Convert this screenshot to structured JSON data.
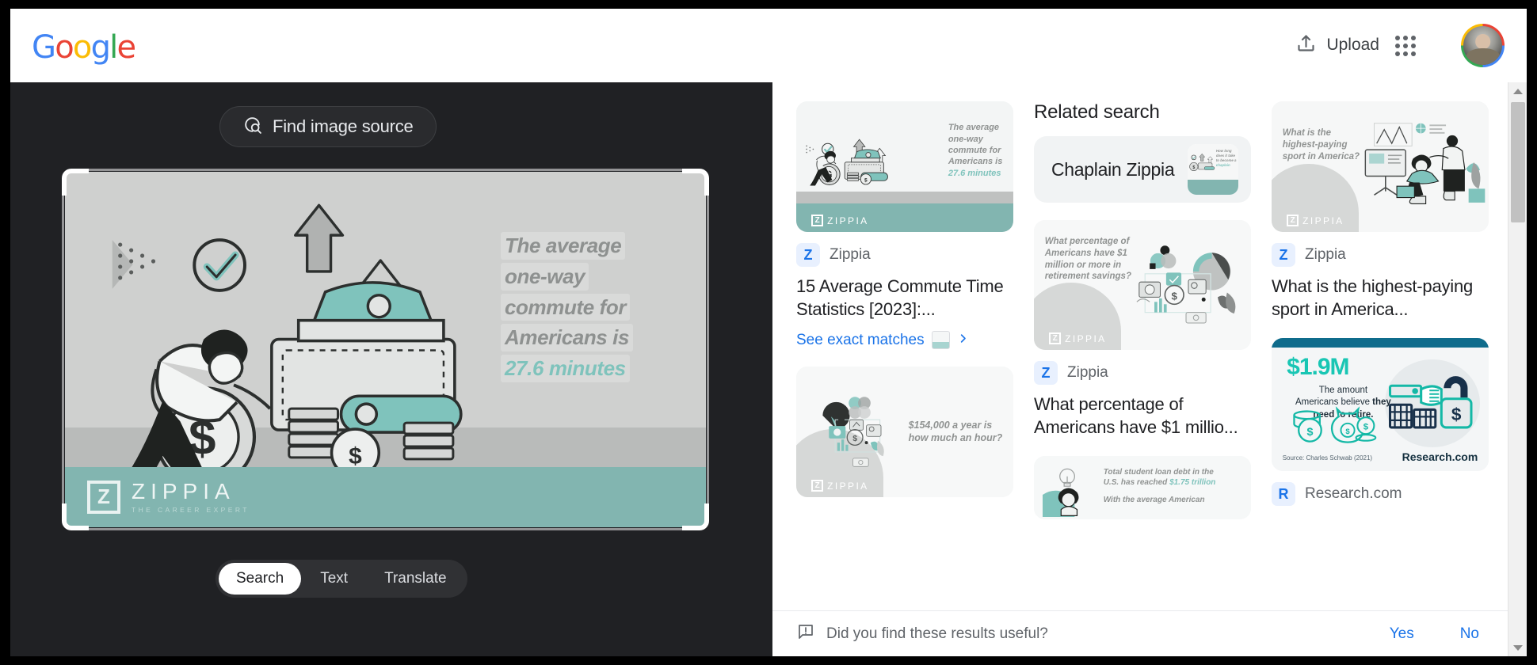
{
  "topbar": {
    "logo_letters": [
      "G",
      "o",
      "o",
      "g",
      "l",
      "e"
    ],
    "upload_label": "Upload",
    "upload_icon": "upload-icon",
    "apps_icon": "apps-grid-icon",
    "avatar_icon": "user-avatar"
  },
  "viewer": {
    "find_source_label": "Find image source",
    "find_source_icon": "image-search-icon",
    "tabs": [
      {
        "label": "Search",
        "active": true
      },
      {
        "label": "Text",
        "active": false
      },
      {
        "label": "Translate",
        "active": false
      }
    ],
    "hero": {
      "lines": [
        "The average",
        "one-way",
        "commute for",
        "Americans is"
      ],
      "accent_line": "27.6 minutes",
      "brand_mark": "Z",
      "brand_word": "ZIPPIA",
      "brand_tagline": "THE CAREER EXPERT"
    }
  },
  "results": {
    "related_search_heading": "Related search",
    "related_pill": {
      "label": "Chaplain Zippia"
    },
    "cards": [
      {
        "source": "Zippia",
        "favicon": "Z",
        "title": "15 Average Commute Time Statistics [2023]:...",
        "exact_matches_label": "See exact matches",
        "thumb": {
          "kind": "zippia-commute",
          "lines": [
            "The average",
            "one-way",
            "commute for",
            "Americans is"
          ],
          "accent_line": "27.6 minutes",
          "brand_word": "ZIPPIA"
        }
      },
      {
        "source": "",
        "favicon": "",
        "title": "",
        "thumb": {
          "kind": "zippia-salary",
          "lines": [
            "$154,000 a year is",
            "how much an hour?"
          ],
          "brand_word": "ZIPPIA"
        }
      },
      {
        "source": "Zippia",
        "favicon": "Z",
        "title": "What percentage of Americans have $1 millio...",
        "thumb": {
          "kind": "zippia-retirement",
          "lines": [
            "What percentage of",
            "Americans have $1",
            "million or more in",
            "retirement savings?"
          ],
          "brand_word": "ZIPPIA"
        }
      },
      {
        "source": "Zippia",
        "favicon": "Z",
        "title": "What is the highest-paying sport in America...",
        "thumb": {
          "kind": "zippia-sport",
          "lines": [
            "What is the",
            "highest-paying",
            "sport in America?"
          ],
          "brand_word": "ZIPPIA"
        }
      },
      {
        "source": "Research.com",
        "favicon": "R",
        "title": "",
        "thumb": {
          "kind": "research-retire",
          "big": "$1.9M",
          "sub_a": "The amount",
          "sub_b": "Americans believe ",
          "sub_bold": "they",
          "sub_c": "need to retire.",
          "source_note": "Source: Charles Schwab (2021)",
          "brand": "Research.com"
        }
      },
      {
        "source": "",
        "favicon": "",
        "title": "",
        "thumb": {
          "kind": "zippia-loan",
          "line_a": "Total student loan debt in the",
          "line_b": "U.S. has reached ",
          "accent": "$1.75 trillion",
          "line_c": "With the average American"
        }
      }
    ]
  },
  "feedback": {
    "icon": "feedback-icon",
    "question": "Did you find these results useful?",
    "yes_label": "Yes",
    "no_label": "No"
  },
  "colors": {
    "accent_blue": "#1a73e8",
    "teal": "#82b5b0",
    "dark_panel": "#202124"
  }
}
